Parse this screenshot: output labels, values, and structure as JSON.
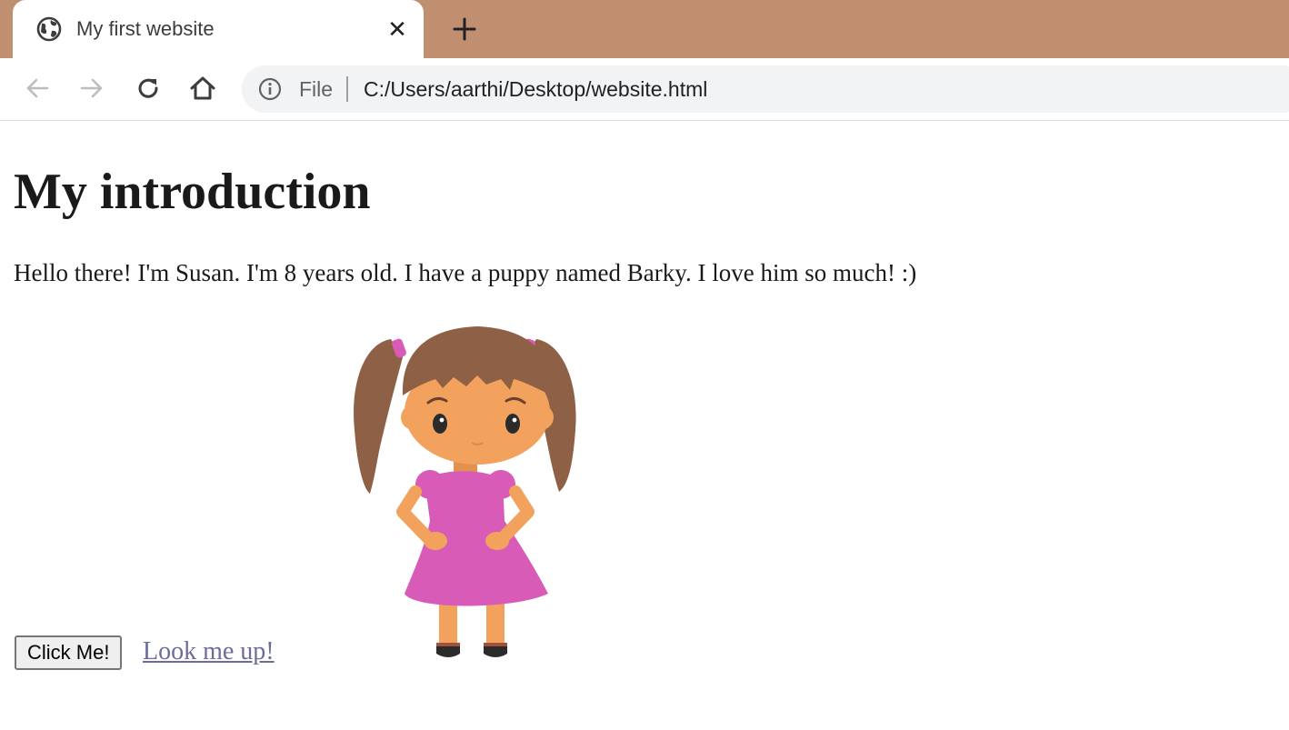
{
  "browser": {
    "tab": {
      "title": "My first website",
      "close_symbol": "✕",
      "favicon": "globe-icon"
    },
    "new_tab_icon": "plus-icon",
    "nav": {
      "back_icon": "arrow-left-icon",
      "forward_icon": "arrow-right-icon",
      "reload_icon": "reload-icon",
      "home_icon": "home-icon"
    },
    "omnibox": {
      "info_icon": "info-icon",
      "scheme_label": "File",
      "url": "C:/Users/aarthi/Desktop/website.html"
    },
    "colors": {
      "tabstrip": "#bf8f6f",
      "omnibox_bg": "#f1f3f4"
    }
  },
  "page": {
    "heading": "My introduction",
    "intro": "Hello there! I'm Susan. I'm 8 years old. I have a puppy named Barky. I love him so much! :)",
    "image": "girl-cartoon-illustration",
    "button_label": "Click Me!",
    "link_label": "Look me up!",
    "colors": {
      "dress": "#d95bb8",
      "hair": "#8e6046",
      "skin": "#f2a25d",
      "link": "#6c6c9c"
    }
  }
}
